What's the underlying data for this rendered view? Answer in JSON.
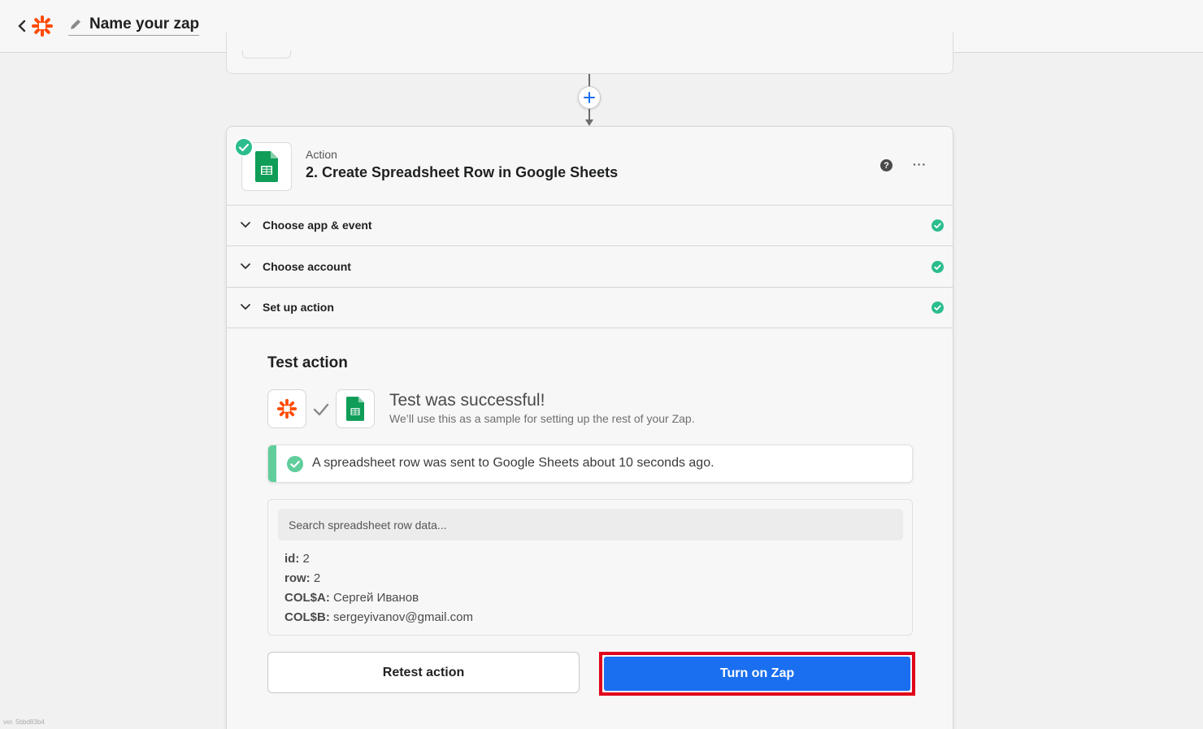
{
  "topbar": {
    "back_icon": "chevron-left-icon",
    "logo_icon": "zapier-asterisk-icon",
    "zap_name": "Name your zap",
    "edit_icon": "pencil-icon"
  },
  "action_card": {
    "step_label": "Action",
    "title": "2. Create Spreadsheet Row in Google Sheets",
    "help_glyph": "?",
    "more_glyph": "···",
    "sections": [
      {
        "label": "Choose app & event",
        "status": "complete"
      },
      {
        "label": "Choose account",
        "status": "complete"
      },
      {
        "label": "Set up action",
        "status": "complete"
      }
    ]
  },
  "test": {
    "title": "Test action",
    "success_title": "Test was successful!",
    "success_subtitle": "We’ll use this as a sample for setting up the rest of your Zap.",
    "notice": "A spreadsheet row was sent to Google Sheets about 10 seconds ago.",
    "search_placeholder": "Search spreadsheet row data...",
    "fields": [
      {
        "key": "id:",
        "value": "2"
      },
      {
        "key": "row:",
        "value": "2"
      },
      {
        "key": "COL$A:",
        "value": "Сергей Иванов"
      },
      {
        "key": "COL$B:",
        "value": "sergeyivanov@gmail.com"
      }
    ]
  },
  "buttons": {
    "retest": "Retest action",
    "turn_on": "Turn on Zap"
  },
  "version": "ver. 5bbd83b4",
  "colors": {
    "accent_blue": "#1a6ff0",
    "success_green": "#2bbd8e",
    "zapier_orange": "#ff4a00",
    "sheets_green": "#0f9d58",
    "highlight_red": "#e0001b"
  }
}
